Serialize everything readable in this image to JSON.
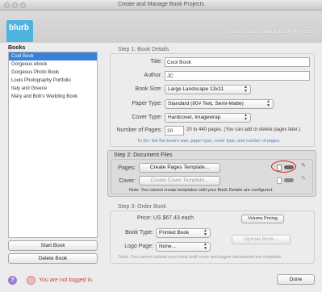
{
  "window": {
    "title": "Create and Manage Book Projects"
  },
  "header": {
    "logo_text": "blurb",
    "title": "Create and Manage Book Projects"
  },
  "sidebar": {
    "label": "Books",
    "items": [
      {
        "label": "Cool Book",
        "selected": true
      },
      {
        "label": "Gorgeous ebook"
      },
      {
        "label": "Gorgeous Photo Book"
      },
      {
        "label": "Louis Photography Portfolio"
      },
      {
        "label": "Italy and Greece"
      },
      {
        "label": "Mary and Bob's Wedding Book"
      }
    ],
    "start_button": "Start Book",
    "delete_button": "Delete Book"
  },
  "step1": {
    "title": "Step 1: Book Details",
    "title_label": "Title:",
    "title_value": "Cool Book",
    "author_label": "Author:",
    "author_value": "JC",
    "size_label": "Book Size:",
    "size_value": "Large Landscape 13x11",
    "paper_label": "Paper Type:",
    "paper_value": "Standard (80# Text, Semi-Matte)",
    "cover_label": "Cover Type:",
    "cover_value": "Hardcover, Imagewrap",
    "pages_label": "Number of Pages:",
    "pages_value": "20",
    "pages_hint": "20 to 440 pages. (You can add or delete pages later.)",
    "todo": "To Do: Set the book's size, paper type, cover type, and number of pages."
  },
  "step2": {
    "title": "Step 2: Document Files",
    "pages_label": "Pages:",
    "pages_button": "Create Pages Template...",
    "cover_label": "Cover:",
    "cover_button": "Create Cover Template...",
    "note": "Note: You cannot create templates until your Book Details are configured."
  },
  "step3": {
    "title": "Step 3: Order Book",
    "price": "Price: US $67.43 each",
    "volume_button": "Volume Pricing",
    "booktype_label": "Book Type:",
    "booktype_value": "Printed Book",
    "logo_label": "Logo Page:",
    "logo_value": "None...",
    "upload_button": "Upload Book...",
    "note": "Note: You cannot upload your book until cover and pages documents are complete."
  },
  "footer": {
    "help": "?",
    "login_status": "You are not logged in.",
    "done_button": "Done"
  },
  "colors": {
    "selection": "#3a80d8",
    "brand": "#4fb3e0",
    "highlight_circle": "#e01010"
  }
}
